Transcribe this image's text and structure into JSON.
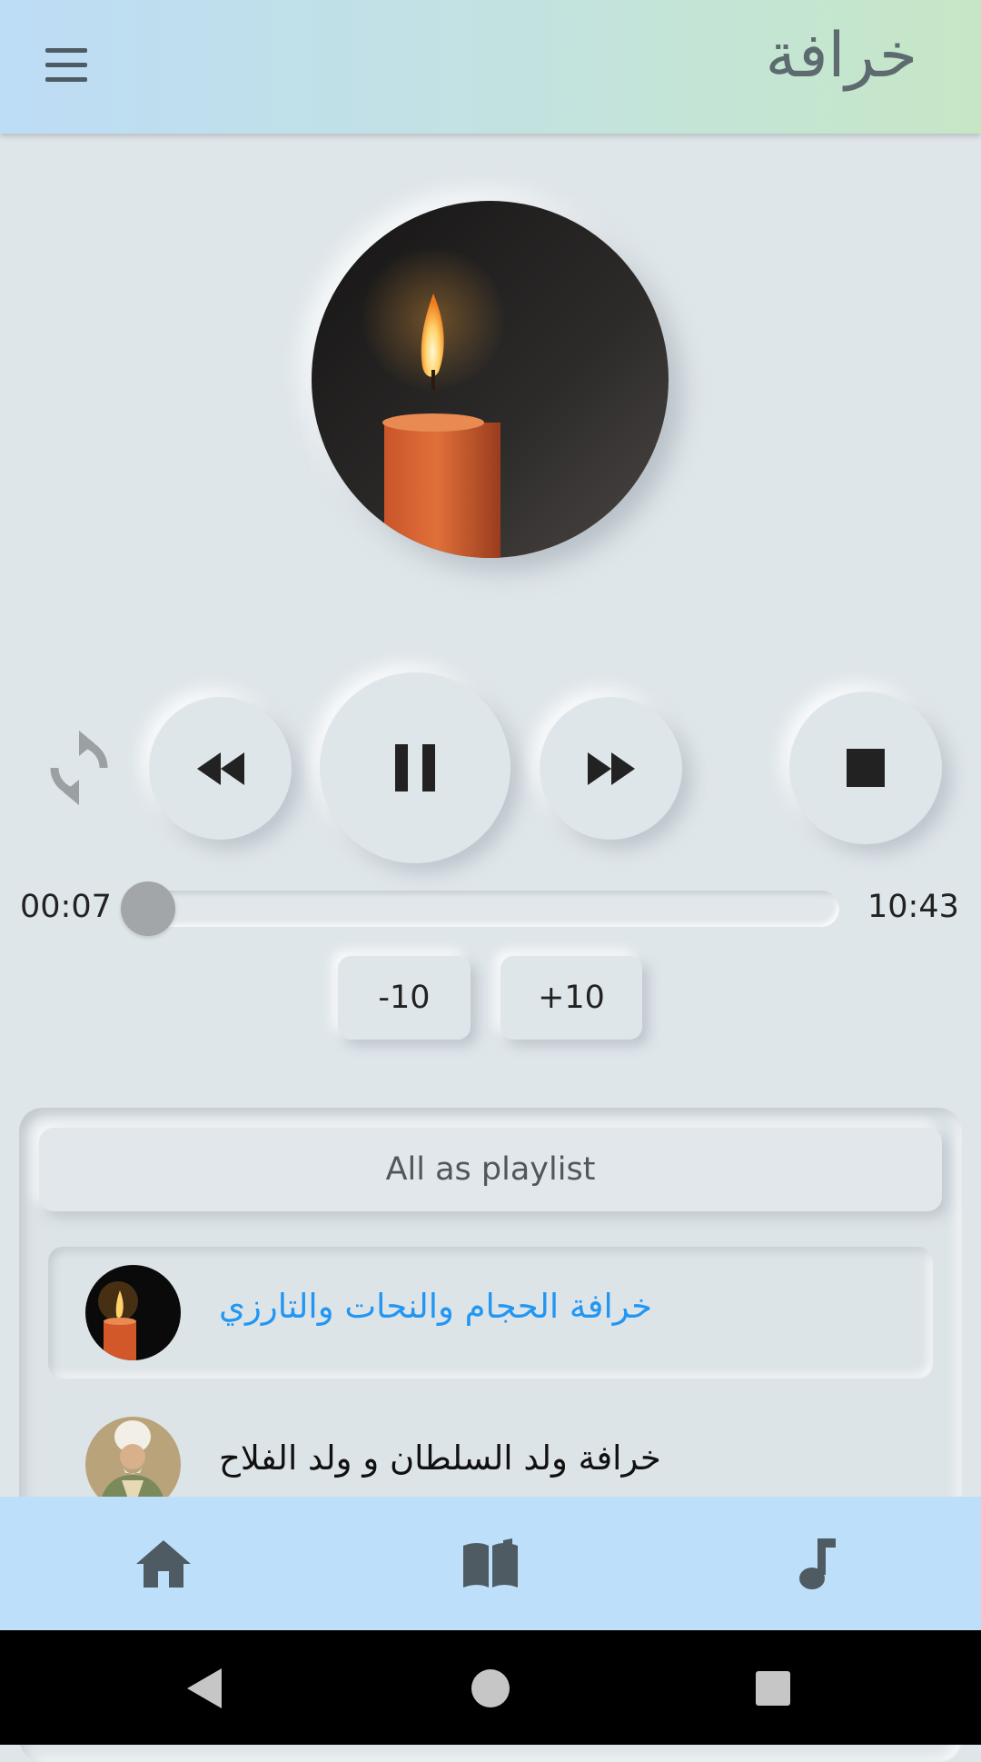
{
  "app": {
    "title": "خرافة"
  },
  "player": {
    "current_time": "00:07",
    "total_time": "10:43",
    "progress": 0.011,
    "seek_back_label": "-10",
    "seek_forward_label": "+10",
    "state": "playing"
  },
  "playlist": {
    "all_as_playlist_label": "All as playlist",
    "items": [
      {
        "title": "خرافة الحجام والنحات والتارزي",
        "active": true,
        "thumbnail": "candle-image"
      },
      {
        "title": "خرافة ولد السلطان و ولد الفلاح",
        "active": false,
        "thumbnail": "sultan-portrait-image"
      }
    ]
  },
  "colors": {
    "accent": "#2196f3",
    "app_bar_start": "#bddcf6",
    "app_bar_end": "#c6e7c6",
    "background": "#dfe6ea",
    "bottom_nav": "#bddff9",
    "icon": "#4e5b63"
  },
  "icons": {
    "menu": "menu-icon",
    "repeat": "repeat-icon",
    "rewind": "rewind-icon",
    "pause": "pause-icon",
    "fast_forward": "fast-forward-icon",
    "stop": "stop-icon",
    "home": "home-icon",
    "book": "book-icon",
    "music": "music-note-icon"
  }
}
